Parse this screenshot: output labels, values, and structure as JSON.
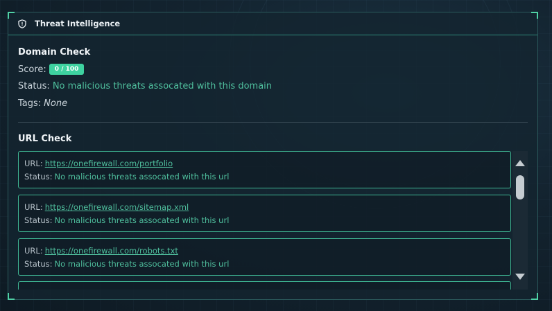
{
  "panel": {
    "title": "Threat Intelligence",
    "icon": "shield-icon"
  },
  "domain_check": {
    "title": "Domain Check",
    "score_label": "Score:",
    "score_value": "0 / 100",
    "status_label": "Status:",
    "status_value": "No malicious threats assocated with this domain",
    "tags_label": "Tags:",
    "tags_value": "None"
  },
  "url_check": {
    "title": "URL Check",
    "items": [
      {
        "url_label": "URL:",
        "url": "https://onefirewall.com/portfolio",
        "status_label": "Status:",
        "status": "No malicious threats assocated with this url"
      },
      {
        "url_label": "URL:",
        "url": "https://onefirewall.com/sitemap.xml",
        "status_label": "Status:",
        "status": "No malicious threats assocated with this url"
      },
      {
        "url_label": "URL:",
        "url": "https://onefirewall.com/robots.txt",
        "status_label": "Status:",
        "status": "No malicious threats assocated with this url"
      }
    ]
  },
  "colors": {
    "accent": "#3ed2a0",
    "status_text": "#4fbf9d",
    "panel_border": "#2b5a5c"
  }
}
